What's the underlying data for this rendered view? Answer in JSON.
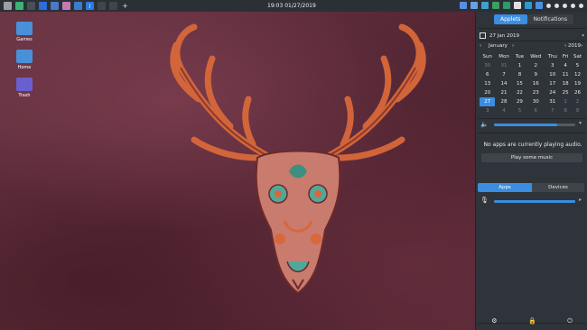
{
  "panel": {
    "clock": "19:03 01/27/2019",
    "launchers": [
      {
        "name": "menu",
        "color": "#9aa0a6"
      },
      {
        "name": "app-green",
        "color": "#3cb371"
      },
      {
        "name": "app-window",
        "color": "#4a4f55"
      },
      {
        "name": "app-blue",
        "color": "#2d6cdf"
      },
      {
        "name": "app-calendar",
        "color": "#4b78c8"
      },
      {
        "name": "app-pink",
        "color": "#c87ab0"
      },
      {
        "name": "app-sheet",
        "color": "#3c7ad0"
      },
      {
        "name": "app-j",
        "color": "#2c79e8",
        "label": "J"
      },
      {
        "name": "app-window2",
        "color": "#3f454b"
      },
      {
        "name": "app-window3",
        "color": "#3f454b"
      }
    ],
    "add_label": "+",
    "tray_colors": [
      "#5a8de0",
      "#6aa0e0",
      "#40a0d0",
      "#3aa060",
      "#2a9d6b",
      "#e0e0e0",
      "#2b9ad0",
      "#4a90e2",
      "#e0e0e0",
      "#e0e0e0",
      "#e0e0e0",
      "#e0e0e0",
      "#e0e0e0"
    ]
  },
  "desktop": {
    "icons": [
      {
        "label": "Games",
        "color": "#4a90d9"
      },
      {
        "label": "Home",
        "color": "#4a90d9"
      },
      {
        "label": "Trash",
        "color": "#6a5fd0"
      }
    ]
  },
  "sidebar": {
    "tabs": {
      "applets": "Applets",
      "notifications": "Notifications"
    },
    "calendar": {
      "date_label": "27 Jan 2019",
      "month": "January",
      "year": "2019",
      "prev": "‹",
      "next": "›",
      "weekdays": [
        "Sun",
        "Mon",
        "Tue",
        "Wed",
        "Thu",
        "Fri",
        "Sat"
      ],
      "weeks": [
        [
          "30",
          "31",
          "1",
          "2",
          "3",
          "4",
          "5"
        ],
        [
          "6",
          "7",
          "8",
          "9",
          "10",
          "11",
          "12"
        ],
        [
          "13",
          "14",
          "15",
          "16",
          "17",
          "18",
          "19"
        ],
        [
          "20",
          "21",
          "22",
          "23",
          "24",
          "25",
          "26"
        ],
        [
          "27",
          "28",
          "29",
          "30",
          "31",
          "1",
          "2"
        ],
        [
          "3",
          "4",
          "5",
          "6",
          "7",
          "8",
          "9"
        ]
      ],
      "today": "27"
    },
    "volume": {
      "level": 0.78,
      "arrow": "▾"
    },
    "audio": {
      "empty_text": "No apps are currently playing audio.",
      "play_button": "Play some music"
    },
    "segments": {
      "apps": "Apps",
      "devices": "Devices"
    },
    "mic": {
      "level": 1.0
    },
    "bottom_icons": [
      "settings",
      "lock",
      "power"
    ]
  }
}
